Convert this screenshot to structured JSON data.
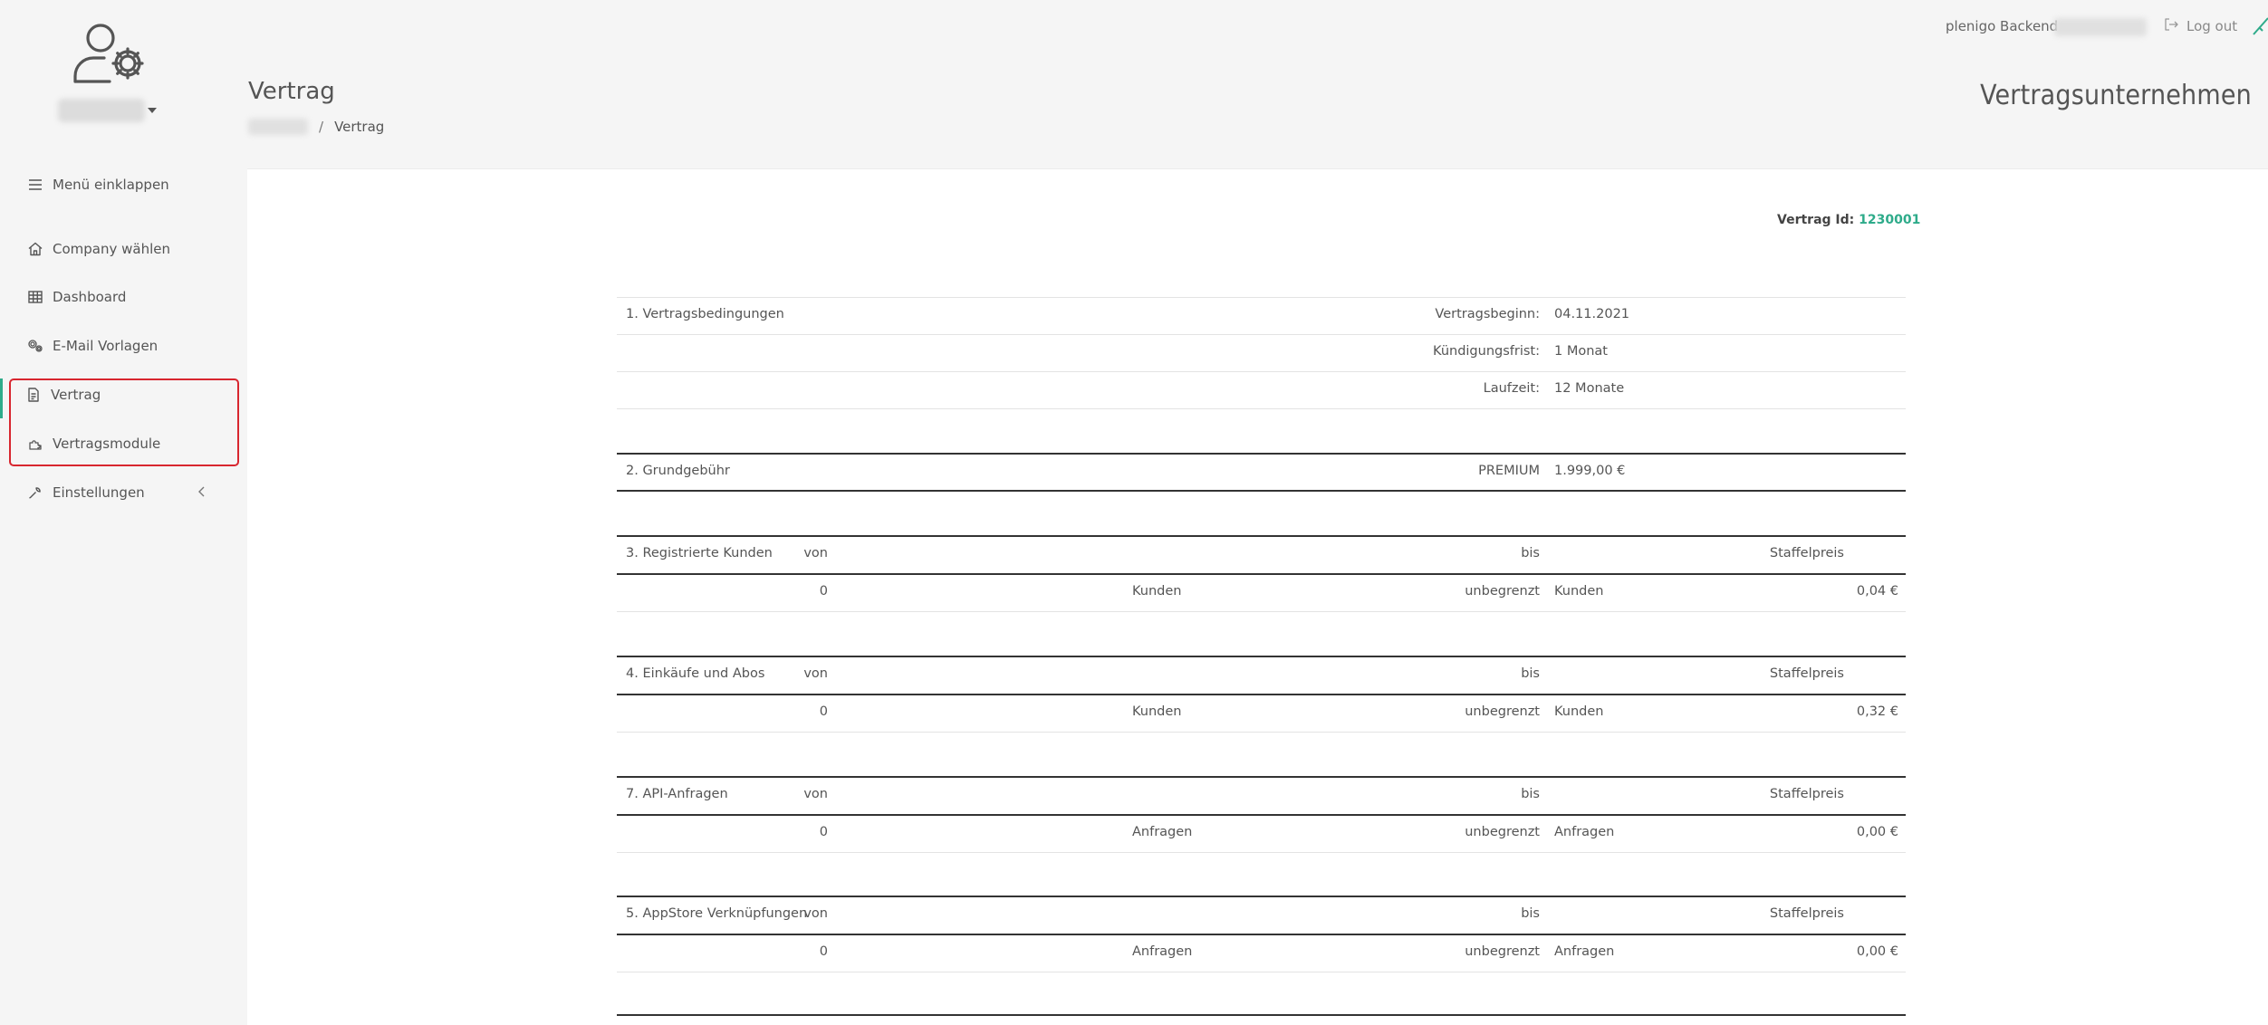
{
  "sidebar": {
    "items": [
      {
        "label": "Menü einklappen"
      },
      {
        "label": "Company wählen"
      },
      {
        "label": "Dashboard"
      },
      {
        "label": "E-Mail Vorlagen"
      },
      {
        "label": "Vertrag"
      },
      {
        "label": "Vertragsmodule"
      },
      {
        "label": "Einstellungen"
      }
    ]
  },
  "topbar": {
    "brand": "plenigo Backend",
    "logout_label": "Log out"
  },
  "header": {
    "title": "Vertrag",
    "breadcrumb_current": "Vertrag",
    "breadcrumb_sep": "/",
    "company_heading": "Vertragsunternehmen"
  },
  "contract": {
    "id_label": "Vertrag Id:",
    "id_value": "1230001",
    "section1": {
      "title": "1. Vertragsbedingungen",
      "rows": [
        {
          "label": "Vertragsbeginn:",
          "value": "04.11.2021"
        },
        {
          "label": "Kündigungsfrist:",
          "value": "1 Monat"
        },
        {
          "label": "Laufzeit:",
          "value": "12 Monate"
        }
      ]
    },
    "section2": {
      "title": "2. Grundgebühr",
      "plan": "PREMIUM",
      "price": "1.999,00 €"
    },
    "tiers": [
      {
        "title": "3. Registrierte Kunden",
        "von": "von",
        "bis": "bis",
        "staffel": "Staffelpreis",
        "from": "0",
        "from_unit": "Kunden",
        "to": "unbegrenzt",
        "to_unit": "Kunden",
        "price": "0,04 €"
      },
      {
        "title": "4. Einkäufe und Abos",
        "von": "von",
        "bis": "bis",
        "staffel": "Staffelpreis",
        "from": "0",
        "from_unit": "Kunden",
        "to": "unbegrenzt",
        "to_unit": "Kunden",
        "price": "0,32 €"
      },
      {
        "title": "7. API-Anfragen",
        "von": "von",
        "bis": "bis",
        "staffel": "Staffelpreis",
        "from": "0",
        "from_unit": "Anfragen",
        "to": "unbegrenzt",
        "to_unit": "Anfragen",
        "price": "0,00 €"
      },
      {
        "title": "5. AppStore Verknüpfungen",
        "von": "von",
        "bis": "bis",
        "staffel": "Staffelpreis",
        "from": "0",
        "from_unit": "Anfragen",
        "to": "unbegrenzt",
        "to_unit": "Anfragen",
        "price": "0,00 €"
      }
    ]
  },
  "colors": {
    "accent": "#2eab8a",
    "highlight": "#d8262f"
  }
}
